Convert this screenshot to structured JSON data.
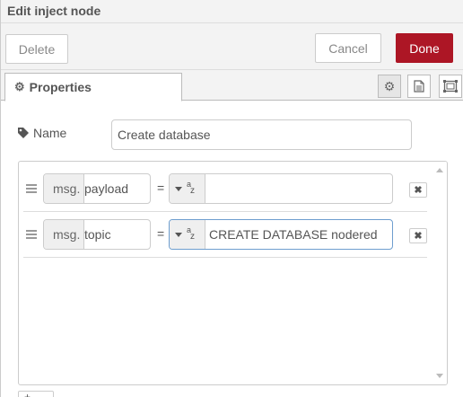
{
  "header": {
    "title": "Edit inject node"
  },
  "toolbar": {
    "delete_label": "Delete",
    "cancel_label": "Cancel",
    "done_label": "Done"
  },
  "tabs": {
    "properties_label": "Properties",
    "icons": [
      "gear-icon",
      "file-text-icon",
      "window-maximize-icon"
    ]
  },
  "form": {
    "name_label": "Name",
    "name_value": "Create database"
  },
  "properties": [
    {
      "prefix": "msg.",
      "property": "payload",
      "operator": "=",
      "type_icon": "string-az-icon",
      "value": ""
    },
    {
      "prefix": "msg.",
      "property": "topic",
      "operator": "=",
      "type_icon": "string-az-icon",
      "value": "CREATE DATABASE nodered"
    }
  ],
  "remove_glyph": "✖",
  "add_label": "+",
  "colors": {
    "done_bg": "#ad1625",
    "focus_border": "#6e9ecf",
    "header_bg": "#f3f3f3"
  }
}
